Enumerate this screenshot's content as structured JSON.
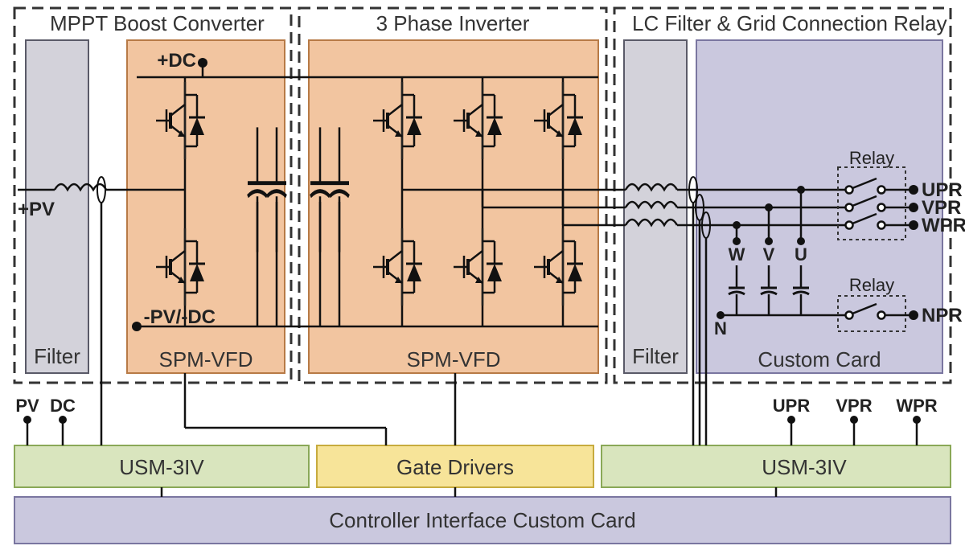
{
  "sections": {
    "mppt": "MPPT Boost Converter",
    "inverter": "3 Phase Inverter",
    "lcfilter": "LC Filter & Grid Connection Relay"
  },
  "blocks": {
    "filter_left": "Filter",
    "spm_vfd_left": "SPM-VFD",
    "spm_vfd_right": "SPM-VFD",
    "filter_right": "Filter",
    "custom_card": "Custom Card",
    "usm_left": "USM-3IV",
    "gate_drivers": "Gate Drivers",
    "usm_right": "USM-3IV",
    "controller_card": "Controller Interface Custom Card"
  },
  "terminals": {
    "pv_plus": "+PV",
    "dc_plus": "+DC",
    "pv_dc_minus": "-PV/-DC",
    "pv": "PV",
    "dc": "DC",
    "upr": "UPR",
    "vpr": "VPR",
    "wpr": "WPR",
    "npr": "NPR",
    "w": "W",
    "v": "V",
    "u": "U",
    "n": "N"
  },
  "relay": "Relay",
  "colors": {
    "spm_fill": "#f2c5a0",
    "filter_fill": "#d3d2da",
    "custom_fill": "#cac8de",
    "usm_fill": "#d9e5be",
    "gate_fill": "#f7e499",
    "controller_fill": "#cac8de",
    "stroke": "#3a3a3a"
  }
}
